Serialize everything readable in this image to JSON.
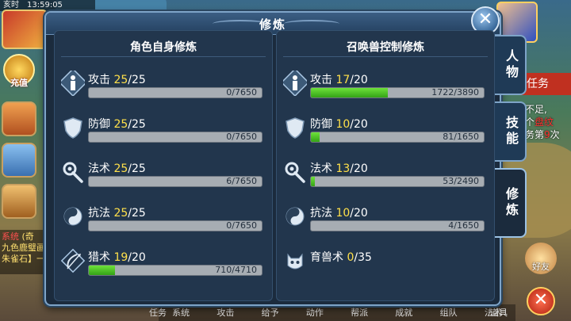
{
  "hud": {
    "clock_label": "亥时",
    "clock_time": "13:59:05",
    "recharge_label": "充值",
    "chat_system": "系统",
    "chat_fragment": "(奇",
    "chat_line1": "九色鹿璧画",
    "chat_line2": "朱雀石】一",
    "task_tab_label": "任务",
    "task_text_1": "需不足,",
    "task_text_2": "一个",
    "task_text_2_red": "盘纹",
    "task_text_3": "任务第",
    "task_text_3_red": "9",
    "task_text_3_end": "次",
    "friend_label": "好友",
    "bottom_menu": [
      "系统",
      "攻击",
      "给予",
      "动作",
      "帮派",
      "成就",
      "组队",
      "法术"
    ],
    "left_bottom_label": "任务",
    "right_bottom_label": "道具"
  },
  "dialog": {
    "title": "修炼",
    "close_label": "✕",
    "side_tabs": [
      "人物",
      "技能",
      "修炼"
    ],
    "active_tab": "修炼"
  },
  "self_cultivation": {
    "title": "角色自身修炼",
    "items": [
      {
        "name": "攻击",
        "level": "25",
        "max": "/25",
        "exp": "0/7650",
        "progress": 0,
        "icon": "attack-icon"
      },
      {
        "name": "防御",
        "level": "25",
        "max": "/25",
        "exp": "0/7650",
        "progress": 0,
        "icon": "defense-icon"
      },
      {
        "name": "法术",
        "level": "25",
        "max": "/25",
        "exp": "6/7650",
        "progress": 0.001,
        "icon": "magic-icon"
      },
      {
        "name": "抗法",
        "level": "25",
        "max": "/25",
        "exp": "0/7650",
        "progress": 0,
        "icon": "resist-icon"
      },
      {
        "name": "猎术",
        "level": "19",
        "max": "/20",
        "exp": "710/4710",
        "progress": 0.151,
        "icon": "hunting-icon"
      }
    ]
  },
  "pet_cultivation": {
    "title": "召唤兽控制修炼",
    "items": [
      {
        "name": "攻击",
        "level": "17",
        "max": "/20",
        "exp": "1722/3890",
        "progress": 0.443,
        "icon": "attack-icon"
      },
      {
        "name": "防御",
        "level": "10",
        "max": "/20",
        "exp": "81/1650",
        "progress": 0.049,
        "icon": "defense-icon"
      },
      {
        "name": "法术",
        "level": "13",
        "max": "/20",
        "exp": "53/2490",
        "progress": 0.021,
        "icon": "magic-icon"
      },
      {
        "name": "抗法",
        "level": "10",
        "max": "/20",
        "exp": "4/1650",
        "progress": 0.002,
        "icon": "resist-icon"
      },
      {
        "name": "育兽术",
        "level": "0",
        "max": "/35",
        "icon": "pet-raising-icon"
      }
    ]
  }
}
